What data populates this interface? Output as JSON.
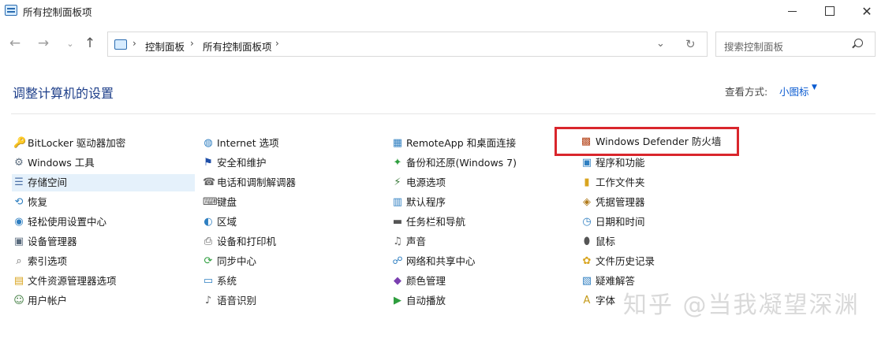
{
  "window": {
    "title": "所有控制面板项"
  },
  "address": {
    "crumbs": [
      "控制面板",
      "所有控制面板项"
    ],
    "separator": "›",
    "dropdown_glyph": "⌄",
    "refresh_glyph": "↻"
  },
  "search": {
    "placeholder": "搜索控制面板"
  },
  "nav": {
    "back": "←",
    "forward": "→",
    "recent": "⌄",
    "up": "↑"
  },
  "header": {
    "title": "调整计算机的设置",
    "view_by_label": "查看方式:",
    "view_by_value": "小图标",
    "view_by_caret": "▼"
  },
  "items": {
    "col1": [
      {
        "label": "BitLocker 驱动器加密",
        "icon": "key-icon",
        "glyph": "🔑",
        "color": "#c49a1a"
      },
      {
        "label": "Windows 工具",
        "icon": "tools-icon",
        "glyph": "⚙",
        "color": "#5a6b7d"
      },
      {
        "label": "存储空间",
        "icon": "storage-icon",
        "glyph": "☰",
        "color": "#4a6fa5"
      },
      {
        "label": "恢复",
        "icon": "recovery-icon",
        "glyph": "⟲",
        "color": "#2f7fc1"
      },
      {
        "label": "轻松使用设置中心",
        "icon": "ease-of-access-icon",
        "glyph": "◉",
        "color": "#2f7fc1"
      },
      {
        "label": "设备管理器",
        "icon": "device-manager-icon",
        "glyph": "▣",
        "color": "#5a6b7d"
      },
      {
        "label": "索引选项",
        "icon": "indexing-icon",
        "glyph": "⌕",
        "color": "#666666"
      },
      {
        "label": "文件资源管理器选项",
        "icon": "folder-options-icon",
        "glyph": "▤",
        "color": "#d9a520"
      },
      {
        "label": "用户帐户",
        "icon": "user-accounts-icon",
        "glyph": "☺",
        "color": "#3c7a3c"
      }
    ],
    "col2": [
      {
        "label": "Internet 选项",
        "icon": "internet-options-icon",
        "glyph": "◍",
        "color": "#2f7fc1"
      },
      {
        "label": "安全和维护",
        "icon": "flag-icon",
        "glyph": "⚑",
        "color": "#1f4fa8"
      },
      {
        "label": "电话和调制解调器",
        "icon": "modem-icon",
        "glyph": "☎",
        "color": "#666666"
      },
      {
        "label": "键盘",
        "icon": "keyboard-icon",
        "glyph": "⌨",
        "color": "#555555"
      },
      {
        "label": "区域",
        "icon": "region-icon",
        "glyph": "◐",
        "color": "#2f7fc1"
      },
      {
        "label": "设备和打印机",
        "icon": "printer-icon",
        "glyph": "⎙",
        "color": "#555555"
      },
      {
        "label": "同步中心",
        "icon": "sync-icon",
        "glyph": "⟳",
        "color": "#2e9e3e"
      },
      {
        "label": "系统",
        "icon": "system-icon",
        "glyph": "▭",
        "color": "#2f7fc1"
      },
      {
        "label": "语音识别",
        "icon": "microphone-icon",
        "glyph": "♪",
        "color": "#666666"
      }
    ],
    "col3": [
      {
        "label": "RemoteApp 和桌面连接",
        "icon": "remoteapp-icon",
        "glyph": "▦",
        "color": "#2f7fc1"
      },
      {
        "label": "备份和还原(Windows 7)",
        "icon": "backup-icon",
        "glyph": "✦",
        "color": "#2e9e3e"
      },
      {
        "label": "电源选项",
        "icon": "power-icon",
        "glyph": "⚡",
        "color": "#3c7a3c"
      },
      {
        "label": "默认程序",
        "icon": "default-programs-icon",
        "glyph": "▥",
        "color": "#2f7fc1"
      },
      {
        "label": "任务栏和导航",
        "icon": "taskbar-icon",
        "glyph": "▬",
        "color": "#555555"
      },
      {
        "label": "声音",
        "icon": "speaker-icon",
        "glyph": "♫",
        "color": "#666666"
      },
      {
        "label": "网络和共享中心",
        "icon": "network-icon",
        "glyph": "☍",
        "color": "#2f7fc1"
      },
      {
        "label": "颜色管理",
        "icon": "color-management-icon",
        "glyph": "◆",
        "color": "#7a3fb0"
      },
      {
        "label": "自动播放",
        "icon": "autoplay-icon",
        "glyph": "▶",
        "color": "#2e9e3e"
      }
    ],
    "col4": [
      {
        "label": "Windows Defender 防火墙",
        "icon": "firewall-icon",
        "glyph": "▩",
        "color": "#b5451b"
      },
      {
        "label": "程序和功能",
        "icon": "programs-icon",
        "glyph": "▣",
        "color": "#2f7fc1"
      },
      {
        "label": "工作文件夹",
        "icon": "work-folders-icon",
        "glyph": "▮",
        "color": "#d9a520"
      },
      {
        "label": "凭据管理器",
        "icon": "credential-icon",
        "glyph": "◈",
        "color": "#b07a1a"
      },
      {
        "label": "日期和时间",
        "icon": "clock-icon",
        "glyph": "◷",
        "color": "#2f7fc1"
      },
      {
        "label": "鼠标",
        "icon": "mouse-icon",
        "glyph": "⬮",
        "color": "#555555"
      },
      {
        "label": "文件历史记录",
        "icon": "file-history-icon",
        "glyph": "✿",
        "color": "#d9a520"
      },
      {
        "label": "疑难解答",
        "icon": "troubleshoot-icon",
        "glyph": "▧",
        "color": "#2f7fc1"
      },
      {
        "label": "字体",
        "icon": "fonts-icon",
        "glyph": "A",
        "color": "#c49a1a"
      }
    ]
  },
  "watermark": "知乎 @当我凝望深渊"
}
